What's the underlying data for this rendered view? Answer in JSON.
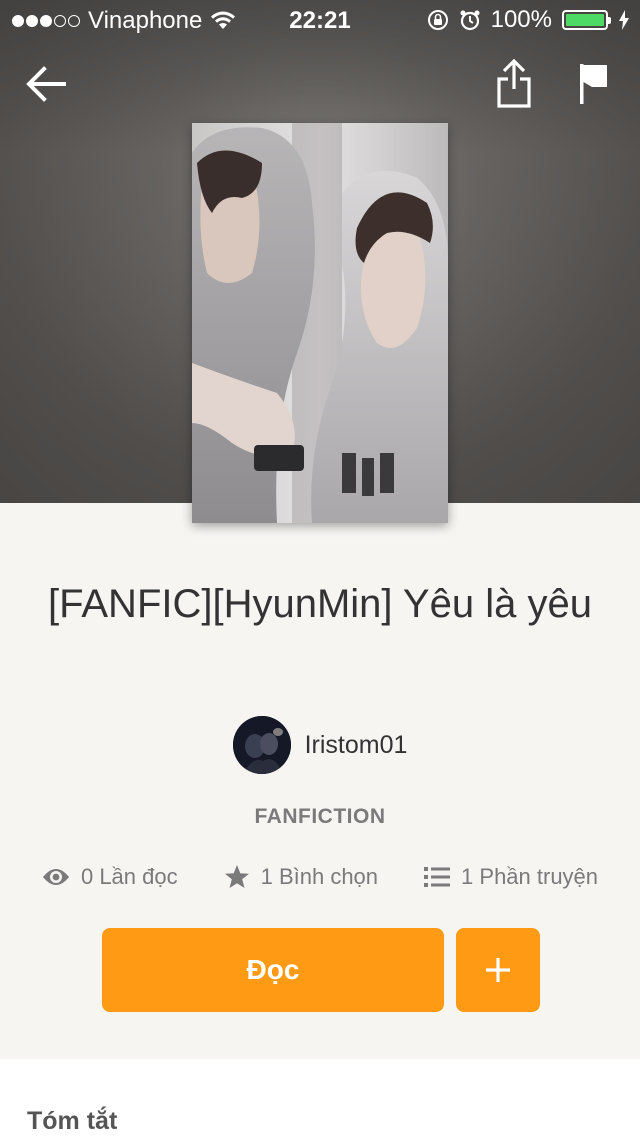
{
  "status_bar": {
    "carrier": "Vinaphone",
    "time": "22:21",
    "battery": "100%",
    "signal_dots_filled": 3,
    "signal_dots_total": 5
  },
  "nav": {
    "back_icon": "arrow-left-icon",
    "share_icon": "share-icon",
    "report_icon": "flag-icon"
  },
  "story": {
    "title": "[FANFIC][HyunMin] Yêu là yêu",
    "author": "Iristom01",
    "category": "FANFICTION",
    "reads": "0 Lần đọc",
    "votes": "1 Bình chọn",
    "parts": "1 Phần truyện"
  },
  "actions": {
    "read_label": "Đọc",
    "add_icon": "plus-icon"
  },
  "summary": {
    "heading": "Tóm tắt"
  },
  "colors": {
    "accent": "#ff9a14",
    "battery": "#4cd964",
    "background": "#f6f5f2"
  }
}
